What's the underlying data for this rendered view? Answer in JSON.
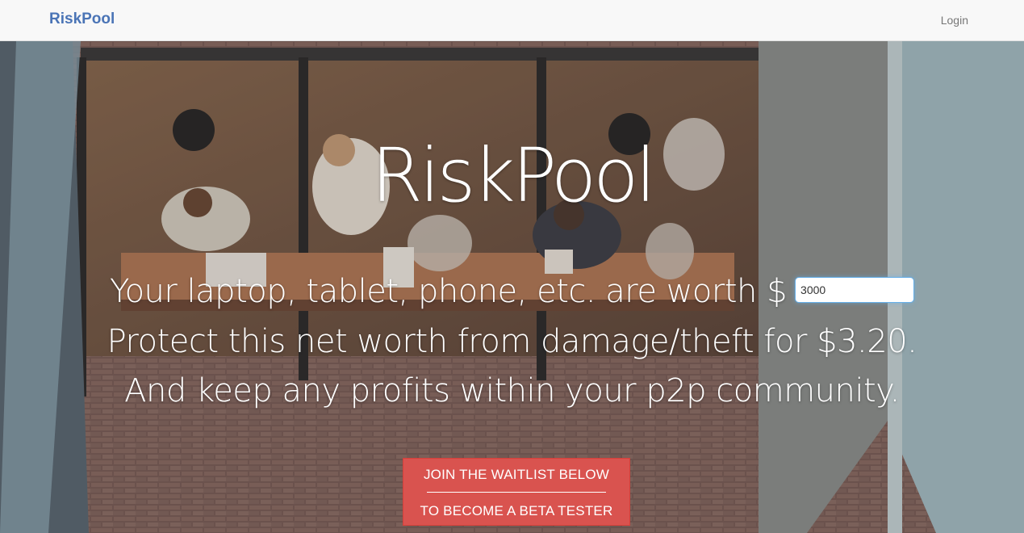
{
  "navbar": {
    "brand": "RiskPool",
    "login_label": "Login"
  },
  "hero": {
    "title": "RiskPool",
    "line1_text": "Your laptop, tablet, phone, etc. are worth $",
    "worth_input_value": "3000",
    "line2_text": "Protect this net worth from damage/theft for $3.20.",
    "line3_text": "And keep any profits within your p2p community.",
    "cta_line1": "JOIN THE WAITLIST BELOW",
    "cta_line2": "TO BECOME A BETA TESTER"
  },
  "colors": {
    "brand": "#4a74b6",
    "cta": "#d9534f",
    "navbar_bg": "#f8f8f8"
  }
}
